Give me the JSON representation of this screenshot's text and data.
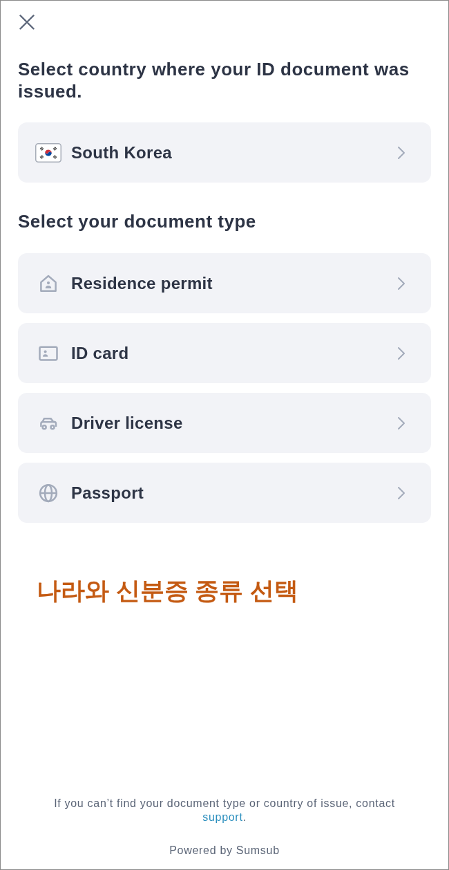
{
  "country_section": {
    "heading": "Select country where your ID document was issued.",
    "country": {
      "name": "South Korea"
    }
  },
  "document_section": {
    "heading": "Select your document type",
    "options": [
      {
        "kind": "residence_permit",
        "label": "Residence permit"
      },
      {
        "kind": "id_card",
        "label": "ID card"
      },
      {
        "kind": "driver_license",
        "label": "Driver license"
      },
      {
        "kind": "passport",
        "label": "Passport"
      }
    ]
  },
  "annotation": {
    "text": "나라와 신분증 종류 선택"
  },
  "footer": {
    "help_text": "If you can’t find your document type or country of issue, contact",
    "link": "support",
    "link_suffix": ".",
    "powered_by": "Powered by Sumsub"
  }
}
